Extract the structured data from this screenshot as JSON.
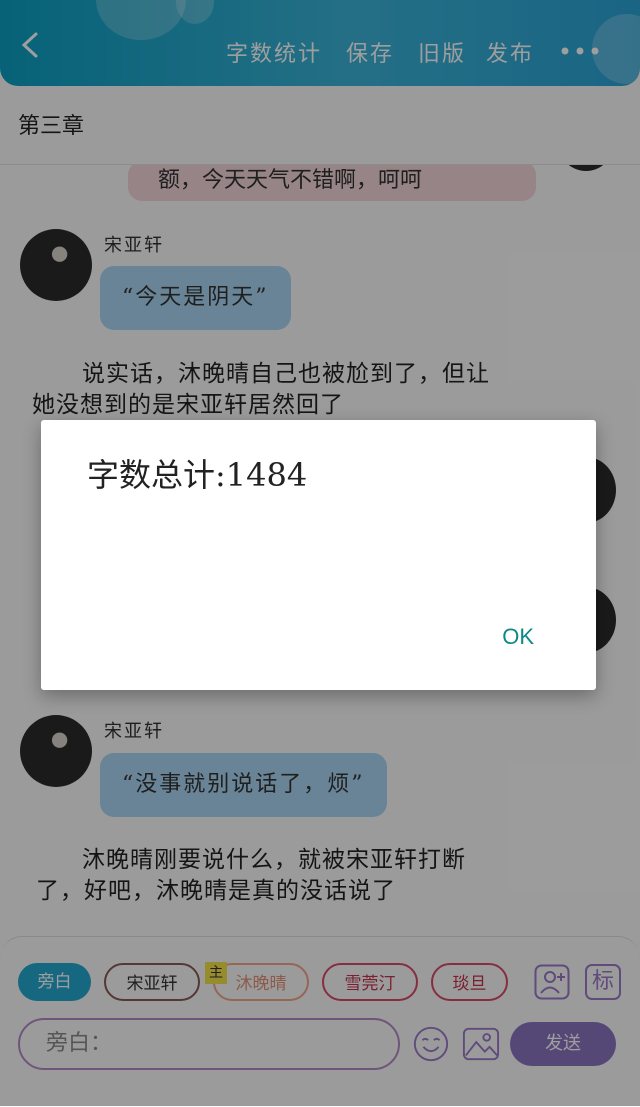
{
  "header": {
    "menu": [
      "字数统计",
      "保存",
      "旧版",
      "发布"
    ],
    "more_icon": "more-dots-icon",
    "back_icon": "back-arrow-icon"
  },
  "chapter_title": "第三章",
  "messages": {
    "partial_top": "额，今天天气不错啊，呵呵",
    "msg1": {
      "name": "宋亚轩",
      "text": "“今天是阴天”"
    },
    "narr1": "说实话，沐晚晴自己也被尬到了，但让",
    "narr1b": "她没想到的是宋亚轩居然回了",
    "msg2": {
      "name": "宋亚轩",
      "text": "“没事就别说话了，烦”"
    },
    "narr2": "沐晚晴刚要说什么，就被宋亚轩打断",
    "narr2b": "了，好吧，沐晚晴是真的没话说了"
  },
  "dialog": {
    "message": "字数总计:1484",
    "ok": "OK"
  },
  "roles": [
    {
      "label": "旁白"
    },
    {
      "label": "宋亚轩"
    },
    {
      "label": "沐晚晴",
      "badge": "主"
    },
    {
      "label": "雪莞汀"
    },
    {
      "label": "琰旦"
    }
  ],
  "input": {
    "placeholder": "旁白："
  },
  "send_label": "发送",
  "tag_icon_label": "标",
  "colors": {
    "header": "#1fa9d0",
    "send": "#8a74c0",
    "ok": "#0c8a86"
  }
}
